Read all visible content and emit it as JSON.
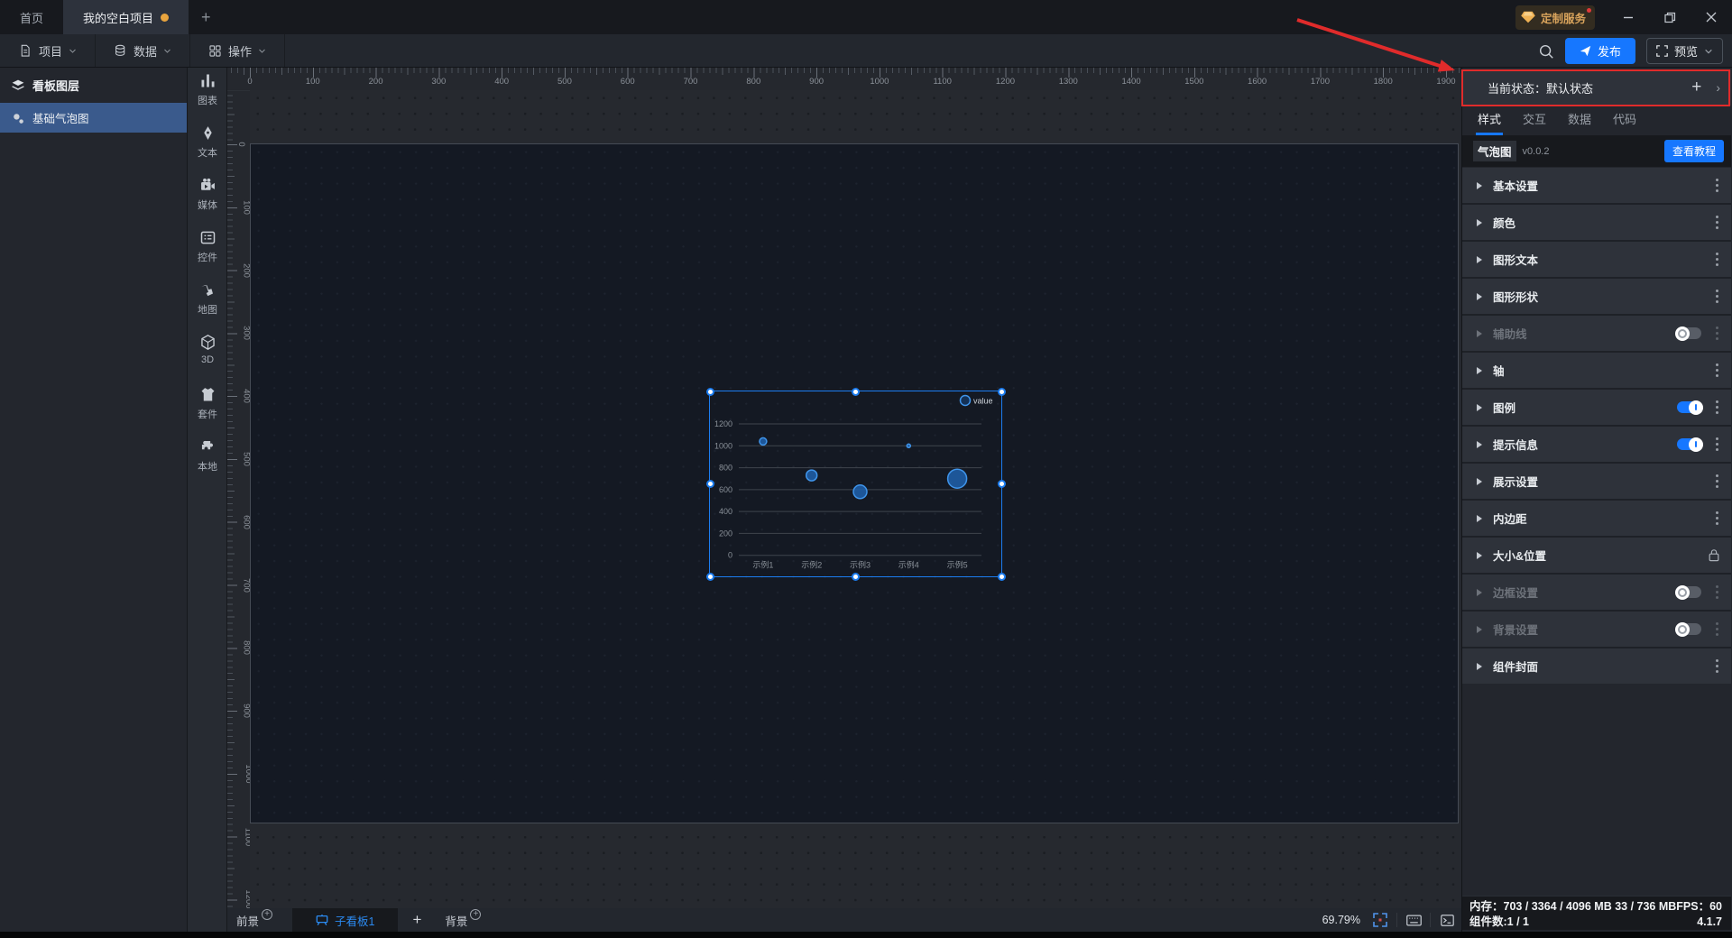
{
  "accent_colors": {
    "primary_blue": "#1677ff",
    "selection_blue": "#1c7df0",
    "active_tab_bg": "#2d323c",
    "selected_layer_bg": "#3a5a8c",
    "badge_gold": "#d9a45c",
    "modified_dot_orange": "#e8a43e",
    "annotation_red": "#e02b2b",
    "bubble_fill": "#1f62ad",
    "bubble_stroke": "#3f94ea"
  },
  "window": {
    "tabs": [
      {
        "label": "首页"
      },
      {
        "label": "我的空白项目"
      }
    ],
    "new_tab_label": "+",
    "customize_badge_label": "定制服务"
  },
  "toolbar": {
    "menus": [
      {
        "id": "project",
        "label": "项目"
      },
      {
        "id": "data",
        "label": "数据"
      },
      {
        "id": "operate",
        "label": "操作"
      }
    ],
    "publish_label": "发布",
    "preview_label": "预览"
  },
  "layers_panel": {
    "title": "看板图层",
    "items": [
      {
        "label": "基础气泡图",
        "selected": true
      }
    ]
  },
  "component_library": {
    "items": [
      {
        "id": "charts",
        "label": "图表"
      },
      {
        "id": "text",
        "label": "文本"
      },
      {
        "id": "media",
        "label": "媒体"
      },
      {
        "id": "control",
        "label": "控件"
      },
      {
        "id": "map",
        "label": "地图"
      },
      {
        "id": "threed",
        "label": "3D"
      },
      {
        "id": "kit",
        "label": "套件"
      },
      {
        "id": "local",
        "label": "本地"
      }
    ]
  },
  "rulers": {
    "h_labels": [
      0,
      100,
      200,
      300,
      400,
      500,
      600,
      700,
      800,
      900,
      1000,
      1100,
      1200,
      1300,
      1400,
      1500,
      1600,
      1700,
      1800,
      1900
    ],
    "v_labels": [
      0,
      100,
      200,
      300,
      400,
      500,
      600,
      700,
      800,
      900,
      1000,
      1100,
      1200
    ]
  },
  "bottom_bar": {
    "foreground_label": "前景",
    "board_tab_label": "子看板1",
    "add_label": "+",
    "background_label": "背景",
    "zoom_percent": "69.79%"
  },
  "right_panel": {
    "state_bar": {
      "label": "当前状态：默认状态",
      "add_label": "+",
      "expand_label": "›"
    },
    "tabs": [
      {
        "label": "样式",
        "active": true
      },
      {
        "label": "交互"
      },
      {
        "label": "数据"
      },
      {
        "label": "代码"
      }
    ],
    "component_header": {
      "name": "气泡图",
      "version": "v0.0.2",
      "tutorial_button": "查看教程"
    },
    "sections": [
      {
        "label": "基本设置"
      },
      {
        "label": "颜色"
      },
      {
        "label": "图形文本"
      },
      {
        "label": "图形形状"
      },
      {
        "label": "辅助线",
        "toggle": "off",
        "disabled": true
      },
      {
        "label": "轴"
      },
      {
        "label": "图例",
        "toggle": "on"
      },
      {
        "label": "提示信息",
        "toggle": "on"
      },
      {
        "label": "展示设置"
      },
      {
        "label": "内边距"
      },
      {
        "label": "大小&位置",
        "lock": true
      },
      {
        "label": "边框设置",
        "toggle": "off",
        "disabled": true
      },
      {
        "label": "背景设置",
        "toggle": "off",
        "disabled": true
      },
      {
        "label": "组件封面"
      }
    ],
    "status_bar": {
      "memory_label": "内存：",
      "memory_value": "703 / 3364 / 4096 MB 33 / 736 MB",
      "fps_label": "FPS：",
      "fps_value": "60",
      "components_label": "组件数:",
      "components_value": "1 / 1",
      "version": "4.1.7"
    }
  },
  "chart_data": {
    "type": "scatter",
    "variant": "bubble",
    "title": "",
    "categories": [
      "示例1",
      "示例2",
      "示例3",
      "示例4",
      "示例5"
    ],
    "series": [
      {
        "name": "value",
        "values": [
          1040,
          730,
          580,
          1000,
          700
        ],
        "bubble_radius_px": [
          4,
          6,
          7.5,
          2,
          10.5
        ]
      }
    ],
    "ylim": [
      0,
      1200
    ],
    "yticks": [
      0,
      200,
      400,
      600,
      800,
      1000,
      1200
    ],
    "grid": true,
    "legend_position": "top-right"
  }
}
